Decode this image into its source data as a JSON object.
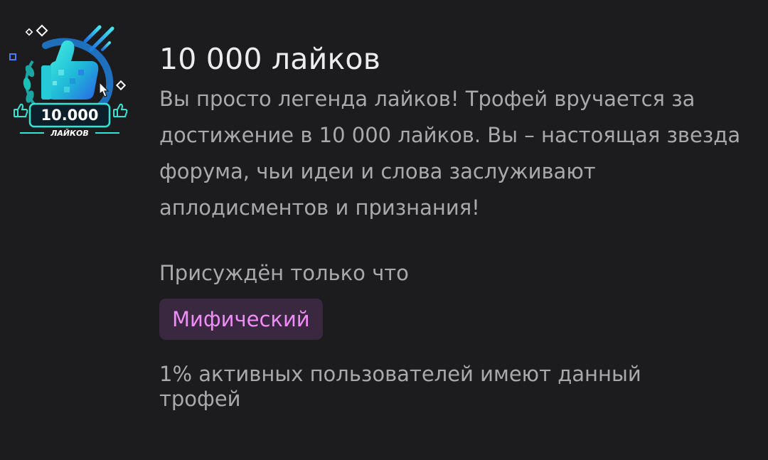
{
  "badge": {
    "number_text": "10.000",
    "caption_text": "ЛАЙКОВ",
    "icon": "thumbs-up-trophy-icon"
  },
  "trophy": {
    "title": "10 000 лайков",
    "description": "Вы просто легенда лайков! Трофей вручается за достижение в 10 000 лайков. Вы – настоящая звезда форума, чьи идеи и слова заслуживают аплодисментов и признания!",
    "awarded": "Присуждён только что",
    "rarity": "Мифический",
    "share": "1% активных пользователей имеют данный трофей"
  },
  "colors": {
    "background": "#1c1c1e",
    "title": "#ececec",
    "text": "#a9a9ab",
    "rarity_text": "#f08cf7",
    "rarity_bg": "#3a2740",
    "badge_accent": "#2ee6d6"
  }
}
